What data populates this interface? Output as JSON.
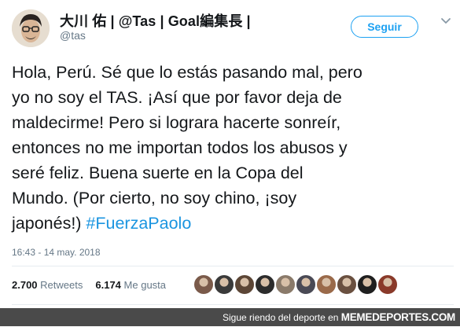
{
  "tweet": {
    "display_name": "大川 佑 | @Tas | Goal編集長 |",
    "handle": "@tas",
    "follow_label": "Seguir",
    "text_lines": [
      "Hola, Perú. Sé que lo estás pasando mal, pero",
      "yo no soy el TAS. ¡Así que por favor deja de",
      "maldecirme! Pero si lograra hacerte sonreír,",
      "entonces no me importan todos los abusos y",
      "seré feliz. Buena suerte en la Copa del",
      "Mundo. (Por cierto, no soy chino, ¡soy",
      "japonés!) "
    ],
    "hashtag": "#FuerzaPaolo",
    "timestamp": "16:43 - 14 may. 2018",
    "retweets_count": "2.700",
    "retweets_label": "Retweets",
    "likes_count": "6.174",
    "likes_label": "Me gusta"
  },
  "likers": [
    {
      "color": "#7a5a4a"
    },
    {
      "color": "#3a3a3a"
    },
    {
      "color": "#5c4636"
    },
    {
      "color": "#2c2c2c"
    },
    {
      "color": "#8a7a6a"
    },
    {
      "color": "#4a4a55"
    },
    {
      "color": "#9a6a4a"
    },
    {
      "color": "#6a5040"
    },
    {
      "color": "#1f1f1f"
    },
    {
      "color": "#8a3a2a"
    }
  ],
  "footer": {
    "text": "Sigue riendo del deporte en ",
    "site": "MEMEDEPORTES.COM"
  },
  "colors": {
    "accent": "#1da1f2",
    "hashtag": "#1b95e0",
    "muted": "#657786",
    "footer_bg": "#4a4a4a"
  }
}
